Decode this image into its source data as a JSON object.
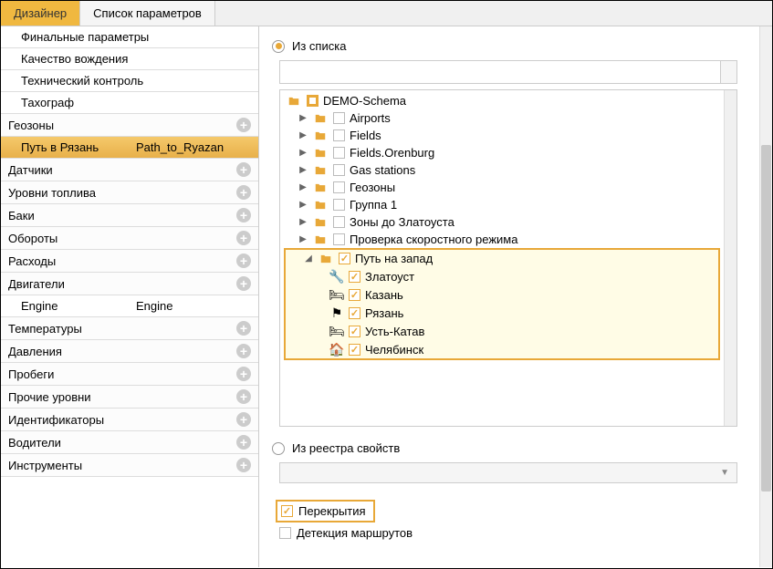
{
  "tabs": {
    "designer": "Дизайнер",
    "params": "Список параметров"
  },
  "left": {
    "subItems": [
      {
        "label": "Финальные параметры"
      },
      {
        "label": "Качество вождения"
      },
      {
        "label": "Технический контроль"
      },
      {
        "label": "Тахограф"
      }
    ],
    "categories": [
      {
        "label": "Геозоны",
        "selected": true,
        "sub": {
          "c1": "Путь в Рязань",
          "c2": "Path_to_Ryazan"
        }
      },
      {
        "label": "Датчики"
      },
      {
        "label": "Уровни топлива"
      },
      {
        "label": "Баки"
      },
      {
        "label": "Обороты"
      },
      {
        "label": "Расходы"
      },
      {
        "label": "Двигатели",
        "sub": {
          "c1": "Engine",
          "c2": "Engine"
        }
      },
      {
        "label": "Температуры"
      },
      {
        "label": "Давления"
      },
      {
        "label": "Пробеги"
      },
      {
        "label": "Прочие уровни"
      },
      {
        "label": "Идентификаторы"
      },
      {
        "label": "Водители"
      },
      {
        "label": "Инструменты"
      }
    ]
  },
  "right": {
    "radio_list": "Из списка",
    "radio_registry": "Из реестра свойств",
    "tree": {
      "root": "DEMO-Schema",
      "folders": [
        "Airports",
        "Fields",
        "Fields.Orenburg",
        "Gas stations",
        "Геозоны",
        "Группа 1",
        "Зоны до Златоуста",
        "Проверка скоростного режима"
      ],
      "highlighted": {
        "folder": "Путь на запад",
        "items": [
          "Златоуст",
          "Казань",
          "Рязань",
          "Усть-Катав",
          "Челябинск"
        ]
      }
    },
    "check_overlap": "Перекрытия",
    "check_routes": "Детекция маршрутов"
  }
}
